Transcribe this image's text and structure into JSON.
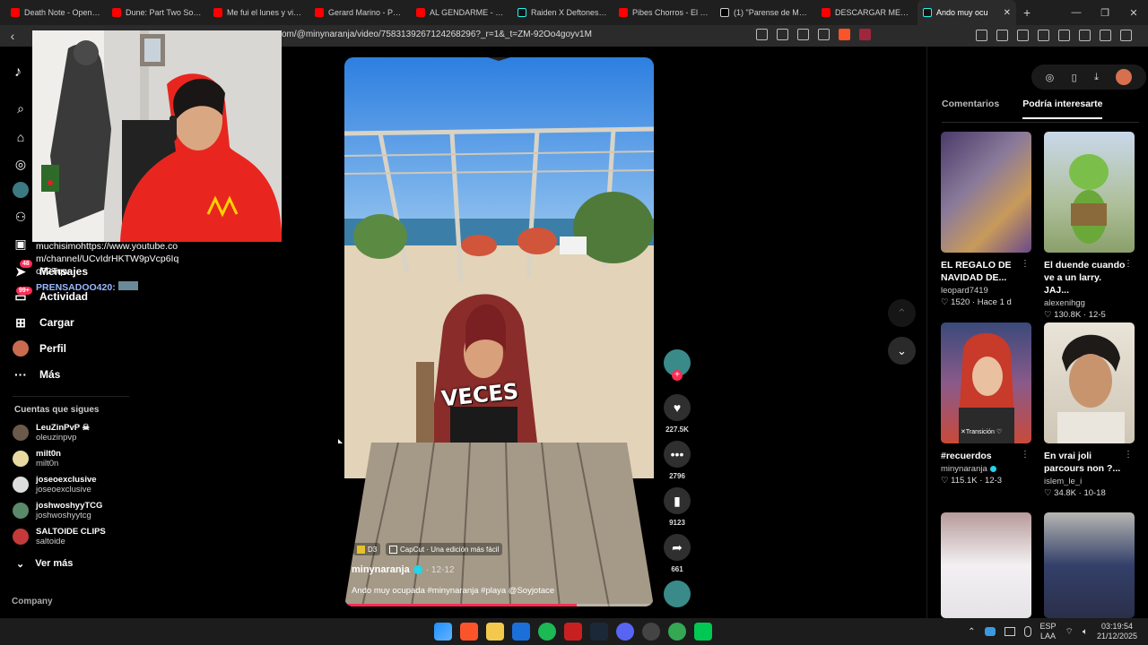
{
  "browser": {
    "tabs": [
      {
        "label": "Death Note - Opening",
        "favicon": "youtube-icon"
      },
      {
        "label": "Dune: Part Two Soundt",
        "favicon": "youtube-icon"
      },
      {
        "label": "Me fui el lunes y vine e",
        "favicon": "youtube-icon"
      },
      {
        "label": "Gerard Marino - Posei",
        "favicon": "youtube-icon"
      },
      {
        "label": "AL GENDARME - KALE",
        "favicon": "youtube-icon"
      },
      {
        "label": "Raiden X Deftones | ib",
        "favicon": "tiktok-icon"
      },
      {
        "label": "Pibes Chorros - El pibe",
        "favicon": "youtube-icon"
      },
      {
        "label": "(1) \"Parense de Manos",
        "favicon": "x-icon"
      },
      {
        "label": "DESCARGAR METAL G",
        "favicon": "youtube-icon"
      },
      {
        "label": "Ando muy ocu",
        "favicon": "tiktok-icon",
        "active": true
      }
    ],
    "url": "om/@minynaranja/video/7583139267124268296?_r=1&_t=ZM-92Oo4goyv1M"
  },
  "sidebar": {
    "nav": [
      {
        "label": "Mensajes",
        "icon": "paper-plane-icon",
        "badge": "48"
      },
      {
        "label": "Actividad",
        "icon": "chat-bubble-icon",
        "badge": "99+"
      },
      {
        "label": "Cargar",
        "icon": "plus-square-icon"
      },
      {
        "label": "Perfil",
        "icon": "avatar-icon"
      },
      {
        "label": "Más",
        "icon": "more-dots-icon"
      }
    ],
    "following_title": "Cuentas que sigues",
    "following": [
      {
        "name": "LeuZinPvP ☠",
        "handle": "oleuzinpvp"
      },
      {
        "name": "milt0n",
        "handle": "milt0n"
      },
      {
        "name": "joseoexclusive",
        "handle": "joseoexclusive"
      },
      {
        "name": "joshwoshyyTCG",
        "handle": "joshwoshyytcg"
      },
      {
        "name": "SALTOIDE CLIPS",
        "handle": "saltoide"
      }
    ],
    "see_more": "Ver más",
    "company": "Company"
  },
  "chat_overlay": {
    "line1": "muchisimohttps://www.youtube.com/channel/UCvIdrHKTW9pVcp6Iqo72Tqw",
    "line2": "PRENSADOO420:"
  },
  "video": {
    "caption_overlay": "VECES",
    "chip1": "D3",
    "chip2": "CapCut · Una edición más fácil",
    "author": "minynaranja",
    "date": "· 12-12",
    "description": "Ando muy ocupada #minynaranja #playa @Soyjotace",
    "progress": 0.75
  },
  "actions": {
    "likes": "227.5K",
    "comments": "2796",
    "saves": "9123",
    "shares": "661"
  },
  "right_panel": {
    "tabs": [
      "Comentarios",
      "Podría interesarte"
    ],
    "active_tab": "Podría interesarte",
    "recs": [
      {
        "title": "EL REGALO DE NAVIDAD DE...",
        "author": "leopard7419",
        "likes": "1520",
        "time": "Hace 1 d"
      },
      {
        "title": "El duende cuando ve a un larry. JAJ...",
        "author": "alexenihgg",
        "likes": "130.8K",
        "time": "12-5"
      },
      {
        "title": "#recuerdos",
        "author": "minynaranja",
        "likes": "115.1K",
        "time": "12-3",
        "thumb_text": "✕Transición ♡"
      },
      {
        "title": "En vrai joli parcours non ?...",
        "author": "islem_le_i",
        "likes": "34.8K",
        "time": "10-18"
      }
    ]
  },
  "taskbar": {
    "lang": "ESP",
    "lang2": "LAA",
    "time": "03:19:54",
    "date": "21/12/2025"
  },
  "colors": {
    "accent": "#fe2c55",
    "background": "#000000"
  }
}
